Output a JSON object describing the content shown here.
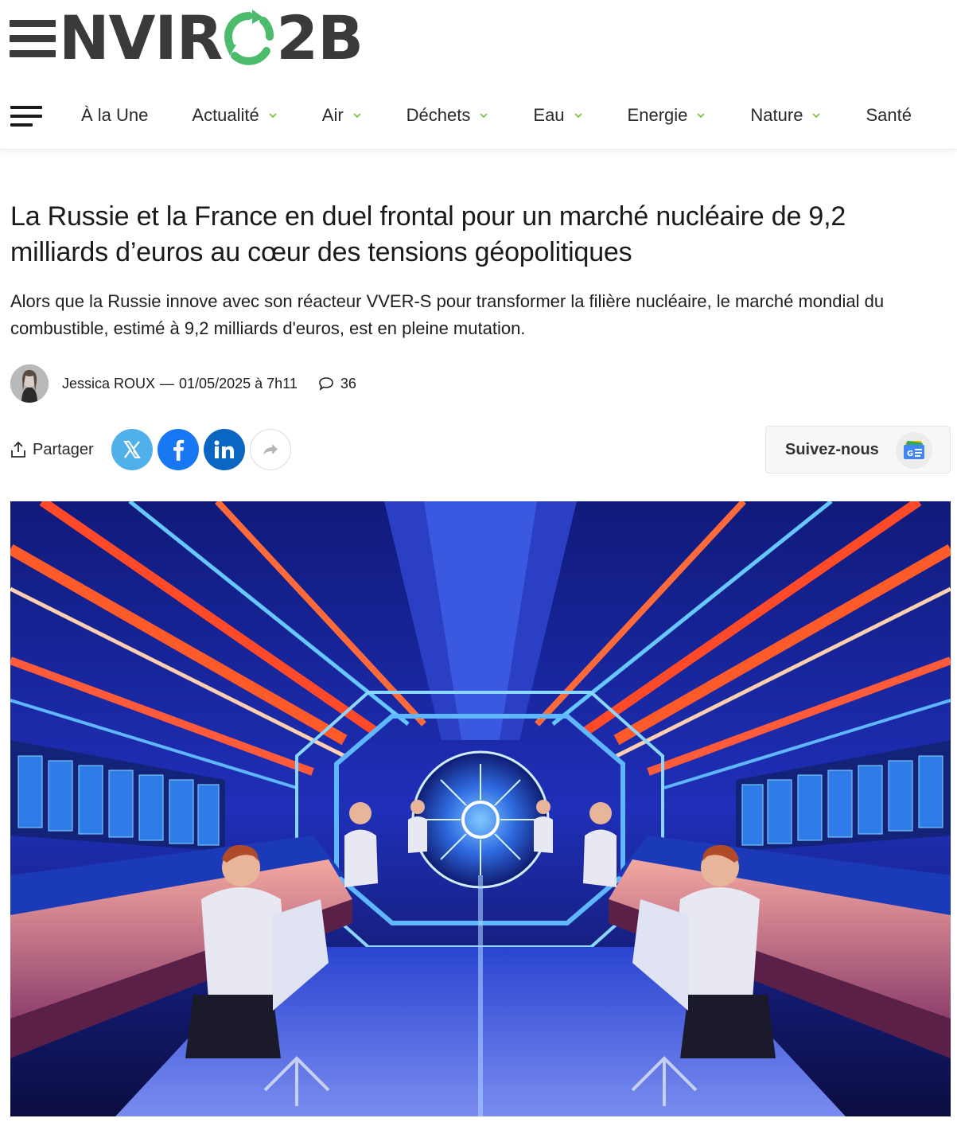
{
  "brand": {
    "logo_left": "NVIR",
    "logo_right": "2B",
    "colors": {
      "dark": "#3a3a3a",
      "green": "#4cbb6c",
      "accent_chevron": "#7bc142"
    }
  },
  "nav": {
    "items": [
      {
        "label": "À la Une",
        "dropdown": false
      },
      {
        "label": "Actualité",
        "dropdown": true
      },
      {
        "label": "Air",
        "dropdown": true
      },
      {
        "label": "Déchets",
        "dropdown": true
      },
      {
        "label": "Eau",
        "dropdown": true
      },
      {
        "label": "Energie",
        "dropdown": true
      },
      {
        "label": "Nature",
        "dropdown": true
      },
      {
        "label": "Santé",
        "dropdown": false
      }
    ]
  },
  "article": {
    "title": "La Russie et la France en duel frontal pour un marché nucléaire de 9,2 milliards d’euros au cœur des tensions géopolitiques",
    "lede": "Alors que la Russie innove avec son réacteur VVER-S pour transformer la filière nucléaire, le marché mondial du combustible, estimé à 9,2 milliards d'euros, est en pleine mutation.",
    "author": "Jessica ROUX",
    "separator": "—",
    "date": "01/05/2025 à 7h11",
    "comments_count": "36"
  },
  "share": {
    "label": "Partager",
    "networks": [
      "x",
      "facebook",
      "linkedin",
      "more"
    ],
    "colors": {
      "x": "#4fb0ea",
      "facebook": "#1877f2",
      "linkedin": "#0a66c2"
    }
  },
  "follow": {
    "label": "Suivez-nous"
  }
}
